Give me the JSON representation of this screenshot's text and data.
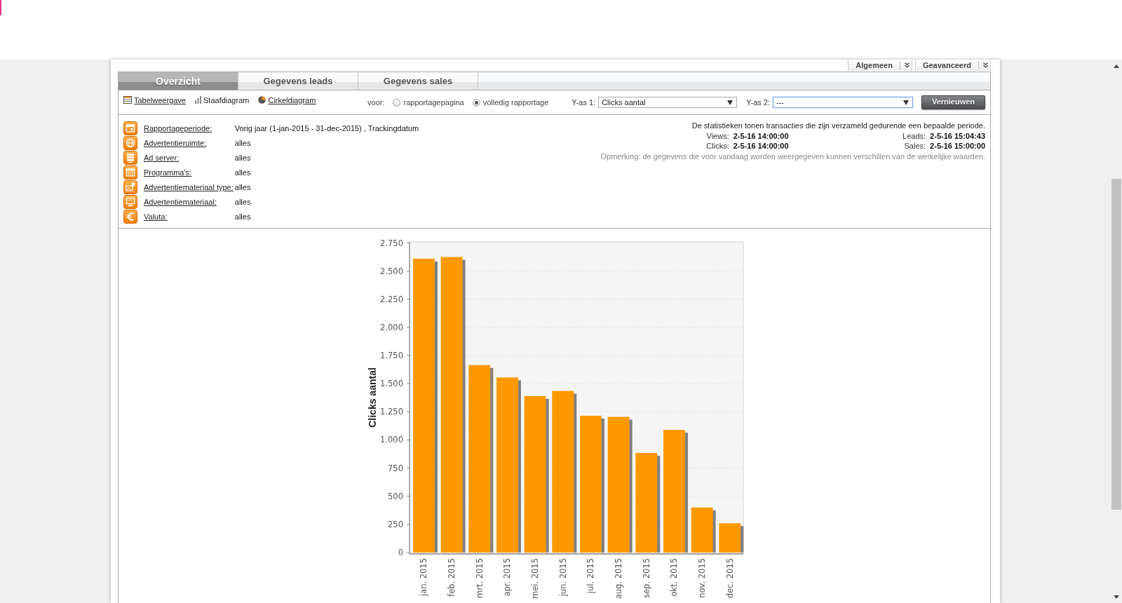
{
  "view_menus": [
    {
      "label": "Algemeen"
    },
    {
      "label": "Geavanceerd"
    }
  ],
  "tabs": [
    {
      "label": "Overzicht",
      "selected": true
    },
    {
      "label": "Gegevens leads",
      "selected": false
    },
    {
      "label": "Gegevens sales",
      "selected": false
    }
  ],
  "toolbar": {
    "view_modes": [
      {
        "kind": "table",
        "label": "Tabelweergave",
        "selected": false
      },
      {
        "kind": "bar",
        "label": "Staafdiagram",
        "selected": true
      },
      {
        "kind": "pie",
        "label": "Cirkeldiagram",
        "selected": false
      }
    ],
    "scope": {
      "label": "voor:",
      "options": [
        {
          "label": "rapportagepagina",
          "selected": false
        },
        {
          "label": "volledig rapportage",
          "selected": true
        }
      ]
    },
    "y_axis_1": {
      "label": "Y-as 1:",
      "value": "Clicks aantal",
      "focused": false
    },
    "y_axis_2": {
      "label": "Y-as 2:",
      "value": "---",
      "focused": true
    },
    "refresh_button": "Vernieuwen"
  },
  "filters": [
    {
      "kind": "calendar",
      "label": "Rapportageperiode:",
      "value": "Vorig jaar (1-jan-2015 - 31-dec-2015) , Trackingdatum"
    },
    {
      "kind": "globe",
      "label": "Advertentieruimte:",
      "value": "alles"
    },
    {
      "kind": "server",
      "label": "Ad server:",
      "value": "alles"
    },
    {
      "kind": "grid",
      "label": "Programma's:",
      "value": "alles"
    },
    {
      "kind": "image",
      "label": "Advertentiemateriaal type:",
      "value": "alles"
    },
    {
      "kind": "monitor",
      "label": "Advertentiemateriaal:",
      "value": "alles"
    },
    {
      "kind": "euro",
      "label": "Valuta:",
      "value": "alles"
    }
  ],
  "info": {
    "description": "De statistieken tonen transacties die zijn verzameld gedurende een bepaalde periode.",
    "timestamps": [
      {
        "label": "Views:",
        "value": "2-5-16 14:00:00"
      },
      {
        "label": "Leads:",
        "value": "2-5-16 15:04:43"
      },
      {
        "label": "Clicks:",
        "value": "2-5-16 14:00:00"
      },
      {
        "label": "Sales:",
        "value": "2-5-16 15:00:00"
      }
    ],
    "note": "Opmerking: de gegevens die voor vandaag worden weergegeven kunnen verschillen van de werkelijke waarden."
  },
  "chart": {
    "chart_data": {
      "type": "bar",
      "ylabel": "Clicks aantal",
      "categories": [
        "jan. 2015",
        "feb. 2015",
        "mrt. 2015",
        "apr. 2015",
        "mei. 2015",
        "jun. 2015",
        "jul. 2015",
        "aug. 2015",
        "sep. 2015",
        "okt. 2015",
        "nov. 2015",
        "dec. 2015"
      ],
      "series": [
        {
          "color": "#ff9900",
          "values": [
            2610,
            2625,
            1665,
            1555,
            1390,
            1435,
            1215,
            1205,
            885,
            1090,
            400,
            260
          ]
        }
      ],
      "ylim": [
        0,
        2750
      ],
      "yticks": [
        0,
        250,
        500,
        750,
        {
          "value": 1000,
          "label": "1.000"
        },
        {
          "value": 1250,
          "label": "1.250"
        },
        {
          "value": 1500,
          "label": "1.500"
        },
        {
          "value": 1750,
          "label": "1.750"
        },
        {
          "value": 2000,
          "label": "2.000"
        },
        {
          "value": 2250,
          "label": "2.250"
        },
        {
          "value": 2500,
          "label": "2.500"
        },
        {
          "value": 2750,
          "label": "2.750"
        }
      ],
      "grid": true
    }
  }
}
